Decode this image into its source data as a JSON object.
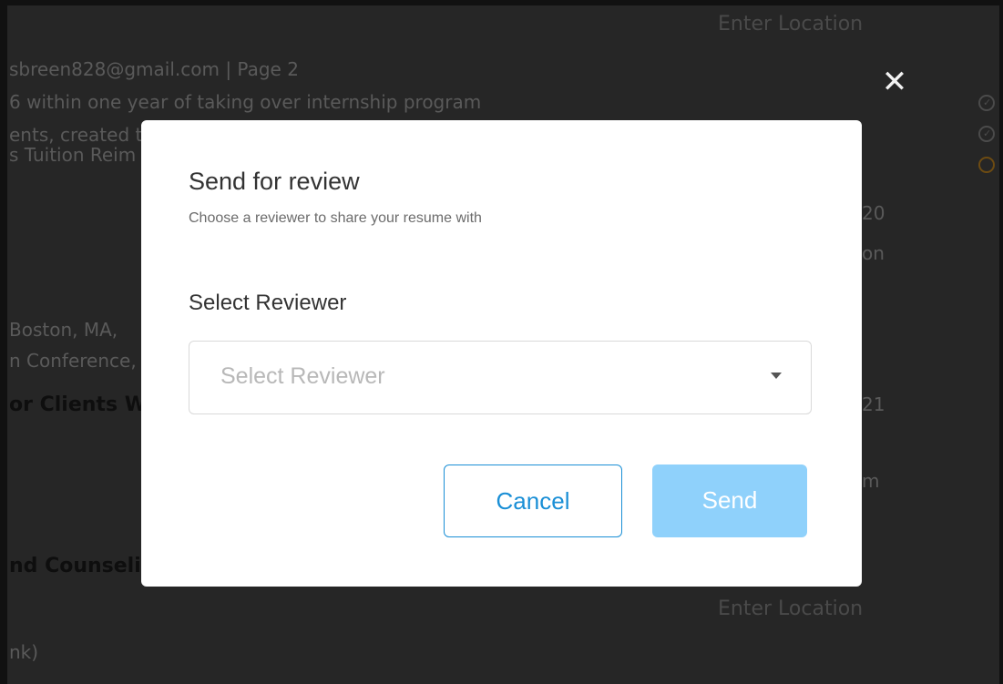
{
  "background": {
    "lines": [
      "sbreen828@gmail.com | Page 2",
      "6 within one year of taking over internship program",
      "ents, created t",
      "s Tuition Reim",
      "Boston, MA,",
      "n Conference,",
      "nk)"
    ],
    "headings": [
      "or Clients W",
      "nd Counseli"
    ],
    "location_placeholder_top": "Enter Location",
    "location_placeholder_bottom": "Enter Location",
    "right_fragments": [
      "20",
      "on",
      "21",
      "m"
    ]
  },
  "modal": {
    "close_icon": "close-icon",
    "title": "Send for review",
    "subtitle": "Choose a reviewer to share your resume with",
    "field_label": "Select Reviewer",
    "select": {
      "placeholder": "Select Reviewer",
      "value": ""
    },
    "cancel_label": "Cancel",
    "send_label": "Send",
    "colors": {
      "accent": "#1a8fd6",
      "send_disabled": "#8fd1fb",
      "overlay": "#262626"
    }
  }
}
